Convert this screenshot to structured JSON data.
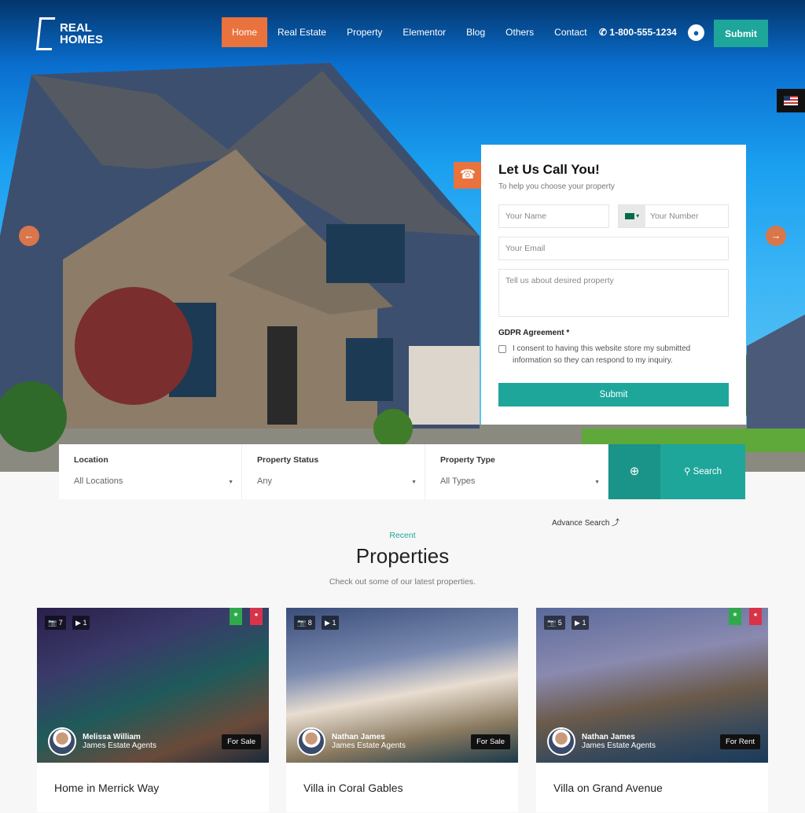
{
  "header": {
    "logo": [
      "REAL",
      "HOMES"
    ],
    "menu": [
      "Home",
      "Real Estate",
      "Property",
      "Elementor",
      "Blog",
      "Others",
      "Contact"
    ],
    "active": "Home",
    "phone": "1-800-555-1234",
    "submit": "Submit",
    "accent": "#ea723d",
    "brand": "#1ea69a"
  },
  "callback": {
    "title": "Let Us Call You!",
    "subtitle": "To help you choose your property",
    "name_placeholder": "Your Name",
    "number_placeholder": "Your Number",
    "email_placeholder": "Your Email",
    "message_placeholder": "Tell us about desired property",
    "gdpr_label": "GDPR Agreement *",
    "consent": "I consent to having this website store my submitted information so they can respond to my inquiry.",
    "submit": "Submit"
  },
  "search": {
    "fields": [
      {
        "label": "Location",
        "value": "All Locations"
      },
      {
        "label": "Property Status",
        "value": "Any"
      },
      {
        "label": "Property Type",
        "value": "All Types"
      }
    ],
    "button": "Search",
    "advance": "Advance Search"
  },
  "section": {
    "kicker": "Recent",
    "title": "Properties",
    "description": "Check out some of our latest properties."
  },
  "properties": [
    {
      "title": "Home in Merrick Way",
      "photos": "7",
      "videos": "1",
      "agent": "Melissa William",
      "company": "James Estate Agents",
      "status": "For Sale",
      "featured": true,
      "hot": true
    },
    {
      "title": "Villa in Coral Gables",
      "photos": "8",
      "videos": "1",
      "agent": "Nathan James",
      "company": "James Estate Agents",
      "status": "For Sale",
      "featured": false,
      "hot": false
    },
    {
      "title": "Villa on Grand Avenue",
      "photos": "5",
      "videos": "1",
      "agent": "Nathan James",
      "company": "James Estate Agents",
      "status": "For Rent",
      "featured": true,
      "hot": true
    }
  ]
}
